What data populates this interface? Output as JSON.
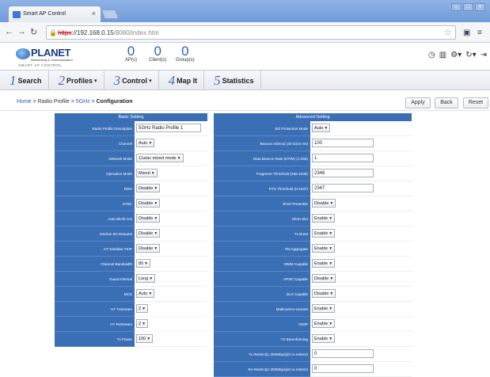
{
  "browser": {
    "tab_title": "Smart AP Control",
    "url_scheme": "https",
    "url_host": "://192.168.0.15",
    "url_path": "/8080/index.htm"
  },
  "app": {
    "logo_name": "PLANET",
    "logo_tagline": "Networking & Communication",
    "logo_sub": "SMART AP CONTROL",
    "counters": [
      {
        "value": "0",
        "label": "AP(s)"
      },
      {
        "value": "0",
        "label": "Client(s)"
      },
      {
        "value": "0",
        "label": "Group(s)"
      }
    ]
  },
  "menu": [
    {
      "num": "1",
      "label": "Search"
    },
    {
      "num": "2",
      "label": "Profiles",
      "caret": "▾"
    },
    {
      "num": "3",
      "label": "Control",
      "caret": "▾"
    },
    {
      "num": "4",
      "label": "Map It"
    },
    {
      "num": "5",
      "label": "Statistics"
    }
  ],
  "breadcrumb": {
    "home": "Home",
    "radio_profile": "Radio Profile",
    "band": "5GHz",
    "current": "Configuration",
    "sep": " > "
  },
  "actions": {
    "apply": "Apply",
    "back": "Back",
    "reset": "Reset"
  },
  "basic": {
    "title": "Basic Setting",
    "rows": [
      {
        "label": "Radio Profile Description",
        "value": "5GHz Radio Profile 1",
        "kind": "input"
      },
      {
        "label": "Channel",
        "value": "Auto",
        "kind": "select"
      },
      {
        "label": "Network Mode",
        "value": "11a/ac mixed mode",
        "kind": "select"
      },
      {
        "label": "Operation Mode",
        "value": "Mixed",
        "kind": "select"
      },
      {
        "label": "RDG",
        "value": "Disable",
        "kind": "select"
      },
      {
        "label": "STBC",
        "value": "Disable",
        "kind": "select"
      },
      {
        "label": "Auto Block Ack",
        "value": "Disable",
        "kind": "select"
      },
      {
        "label": "Decline BA Request",
        "value": "Disable",
        "kind": "select"
      },
      {
        "label": "HT Disallow TKIP",
        "value": "Disable",
        "kind": "select"
      },
      {
        "label": "Channel Bandwidth",
        "value": "80",
        "kind": "select"
      },
      {
        "label": "Guard Interval",
        "value": "Long",
        "kind": "select"
      },
      {
        "label": "MCS",
        "value": "Auto",
        "kind": "select"
      },
      {
        "label": "HT TxStream",
        "value": "2",
        "kind": "select"
      },
      {
        "label": "HT RxStream",
        "value": "2",
        "kind": "select"
      },
      {
        "label": "Tx Power",
        "value": "100",
        "kind": "select"
      }
    ]
  },
  "advanced": {
    "title": "Advanced Setting",
    "rows": [
      {
        "label": "BG Protection Mode",
        "value": "Auto",
        "kind": "select"
      },
      {
        "label": "Beacon Interval (20-1024 ms)",
        "value": "100",
        "kind": "input"
      },
      {
        "label": "Data Beacon Rate (DTIM) (1-255)",
        "value": "1",
        "kind": "input"
      },
      {
        "label": "Fragment Threshold (256-2346)",
        "value": "2346",
        "kind": "input"
      },
      {
        "label": "RTS Threshold (0-2347)",
        "value": "2347",
        "kind": "input"
      },
      {
        "label": "Short Preamble",
        "value": "Disable",
        "kind": "select"
      },
      {
        "label": "Short Slot",
        "value": "Enable",
        "kind": "select"
      },
      {
        "label": "Tx Burst",
        "value": "Enable",
        "kind": "select"
      },
      {
        "label": "Pkt Aggregate",
        "value": "Enable",
        "kind": "select"
      },
      {
        "label": "WMM Capable",
        "value": "Enable",
        "kind": "select"
      },
      {
        "label": "APSD Capable",
        "value": "Disable",
        "kind": "select"
      },
      {
        "label": "DLS Capable",
        "value": "Disable",
        "kind": "select"
      },
      {
        "label": "Multicast-to-Unicast",
        "value": "Enable",
        "kind": "select"
      },
      {
        "label": "IGMP",
        "value": "Enable",
        "kind": "select"
      },
      {
        "label": "TX Beamforming",
        "value": "Enable",
        "kind": "select"
      },
      {
        "label": "Tx Restrict(1-300Mbps)(0:no restrict)",
        "value": "0",
        "kind": "input"
      },
      {
        "label": "Rx Restrict(1-300Mbps)(0:no restrict)",
        "value": "0",
        "kind": "input"
      }
    ]
  },
  "colors": {
    "panel_blue": "#3a6fb6",
    "accent": "#2a62c0"
  }
}
